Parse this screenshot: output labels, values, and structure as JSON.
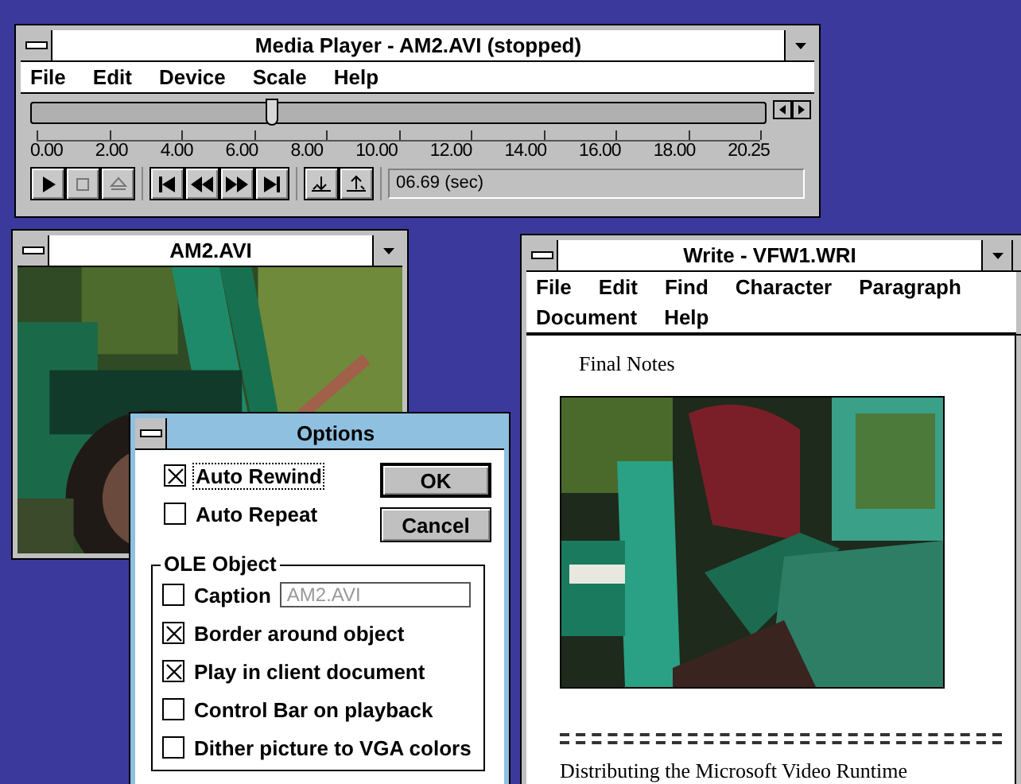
{
  "media_player": {
    "title": "Media Player - AM2.AVI (stopped)",
    "menu": [
      "File",
      "Edit",
      "Device",
      "Scale",
      "Help"
    ],
    "position": {
      "level": 0.33
    },
    "scale_labels": [
      "0.00",
      "2.00",
      "4.00",
      "6.00",
      "8.00",
      "10.00",
      "12.00",
      "14.00",
      "16.00",
      "18.00",
      "20.25"
    ],
    "readout": "06.69 (sec)"
  },
  "video_window": {
    "title": "AM2.AVI"
  },
  "write": {
    "title": "Write - VFW1.WRI",
    "menu": [
      "File",
      "Edit",
      "Find",
      "Character",
      "Paragraph",
      "Document",
      "Help"
    ],
    "heading": "Final Notes",
    "body_text": "Distributing the Microsoft Video Runtime"
  },
  "options": {
    "title": "Options",
    "checks": [
      {
        "label": "Auto Rewind",
        "checked": true,
        "selected": true
      },
      {
        "label": "Auto Repeat",
        "checked": false,
        "selected": false
      }
    ],
    "buttons": [
      "OK",
      "Cancel"
    ],
    "ole_group": {
      "label": "OLE Object",
      "caption": {
        "label": "Caption",
        "checked": false,
        "value": "AM2.AVI",
        "disabled": true
      },
      "checks": [
        {
          "label": "Border around object",
          "checked": true
        },
        {
          "label": "Play in client document",
          "checked": true
        },
        {
          "label": "Control Bar on playback",
          "checked": false
        },
        {
          "label": "Dither picture to VGA colors",
          "checked": false
        }
      ]
    }
  }
}
